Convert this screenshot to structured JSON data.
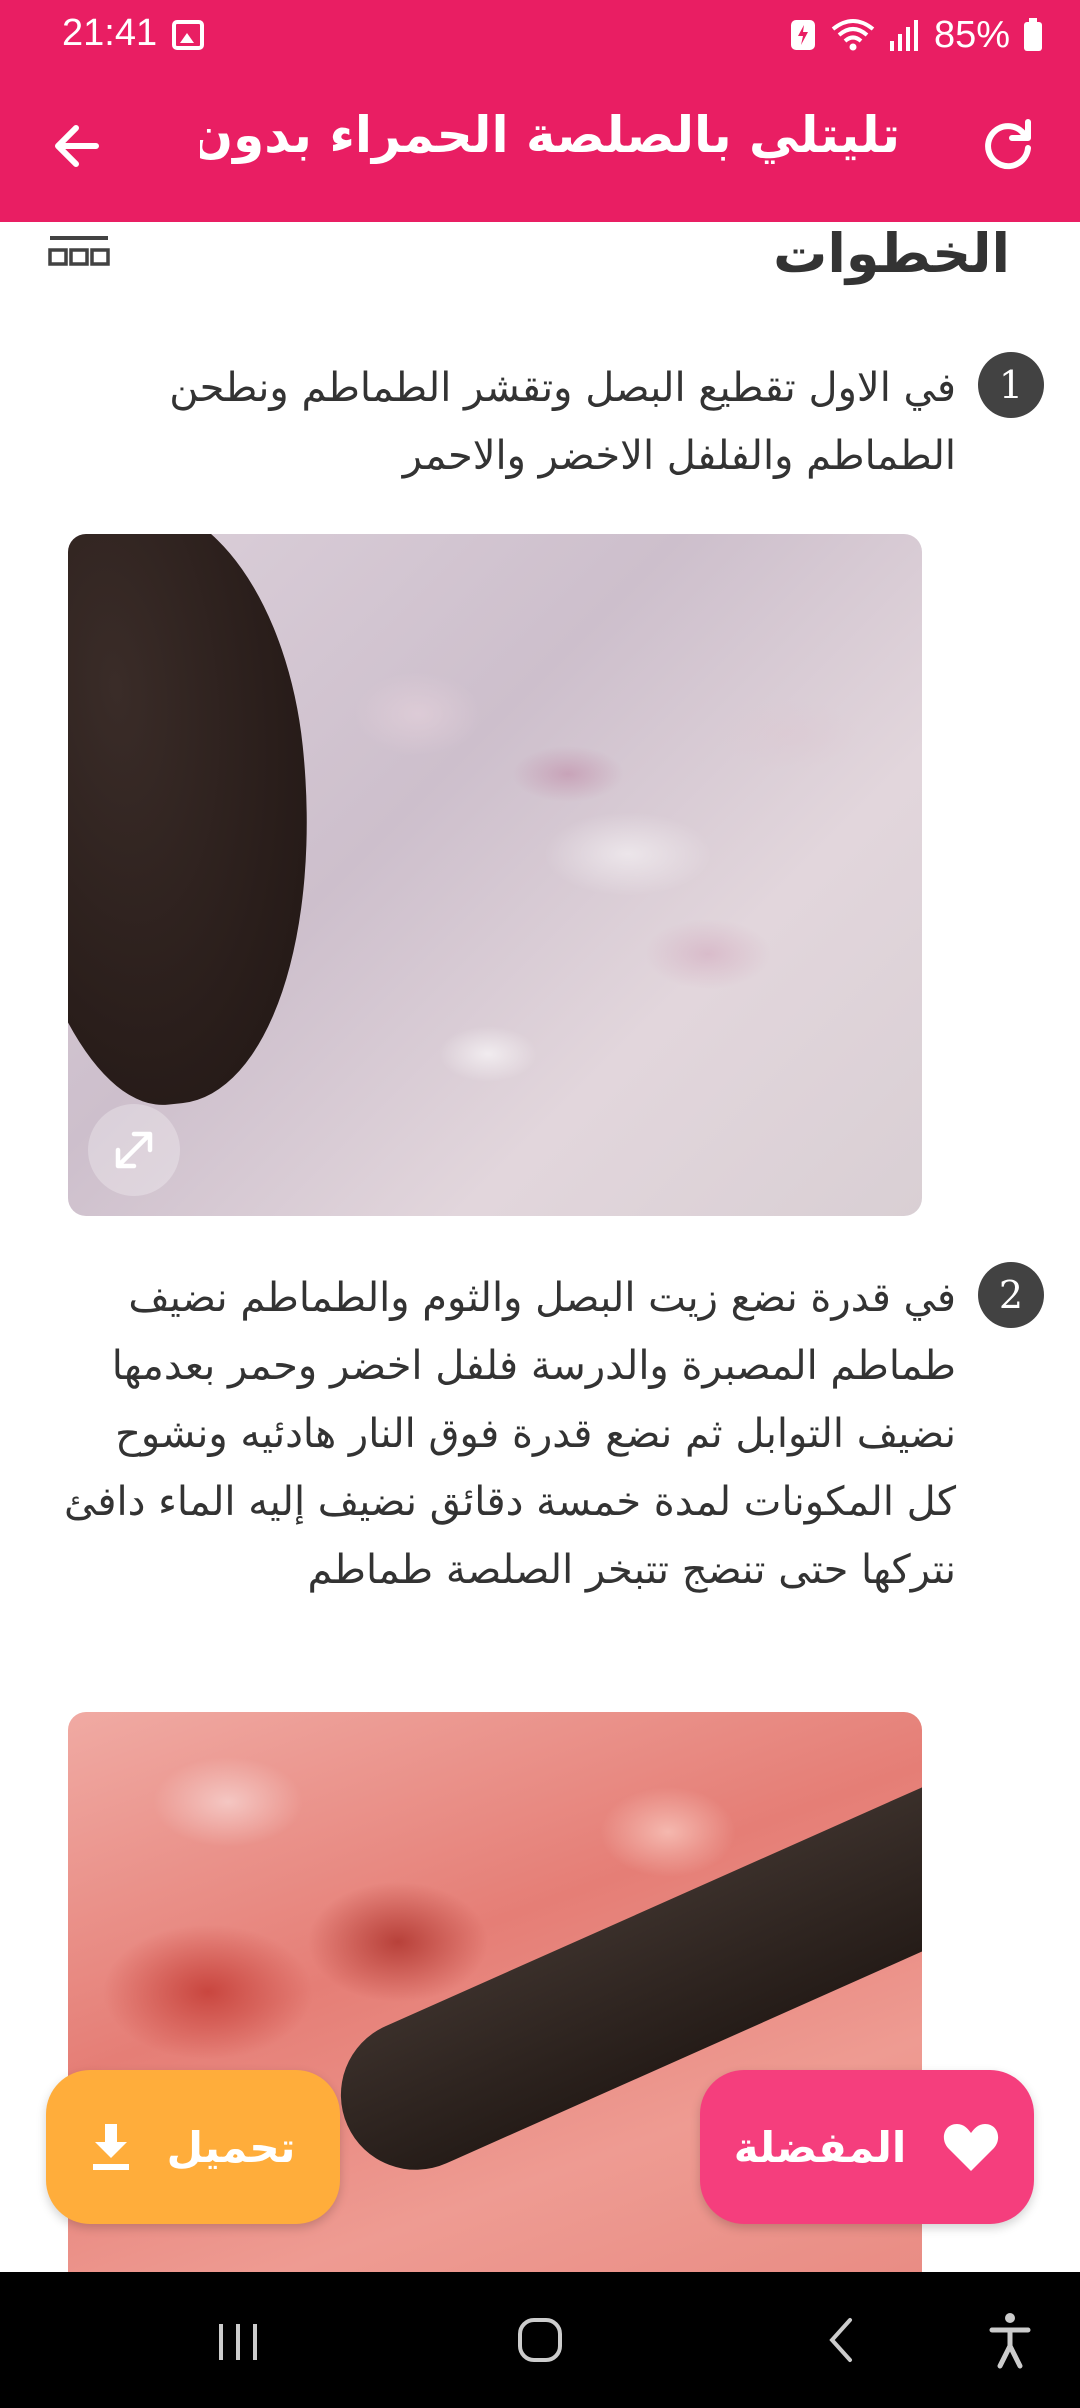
{
  "status_bar": {
    "time": "21:41",
    "battery_percent": "85%",
    "icons": [
      "image-icon",
      "battery-saver-icon",
      "wifi-icon",
      "signal-icon",
      "battery-icon"
    ]
  },
  "app_bar": {
    "title": "تليتلي بالصلصة الحمراء بدون ...",
    "icons": [
      "back-arrow-icon",
      "refresh-icon"
    ]
  },
  "section": {
    "title": "الخطوات",
    "view_toggle_icon": "grid-view-icon"
  },
  "steps": [
    {
      "number": "1",
      "text": "في الاول تقطيع البصل وتقشر الطماطم ونطحن الطماطم والفلفل الاخضر والاحمر",
      "photo_expand_icon": "expand-icon"
    },
    {
      "number": "2",
      "text": "في قدرة نضع زيت البصل والثوم والطماطم نضيف طماطم المصبرة والدرسة فلفل اخضر وحمر بعدمها نضيف التوابل ثم نضع قدرة فوق النار هادئيه ونشوح كل المكونات لمدة خمسة دقائق نضيف إليه الماء دافئ نتركها حتى تنضج تتبخر الصلصة طماطم"
    }
  ],
  "buttons": {
    "download_label": "تحميل",
    "favorite_label": "المفضلة"
  },
  "colors": {
    "primary": "#e91e63",
    "download": "#ffad3b",
    "favorite": "#f53e7d",
    "step_badge": "#424242"
  }
}
